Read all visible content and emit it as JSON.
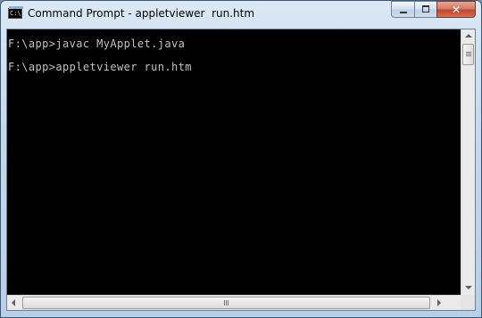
{
  "window": {
    "title": "Command Prompt - appletviewer  run.htm",
    "icon": "console-icon",
    "icon_text": "C:\\"
  },
  "caption_buttons": {
    "minimize": "minimize-icon",
    "maximize": "maximize-icon",
    "close_label": "✕"
  },
  "console": {
    "lines": [
      "F:\\app>javac MyApplet.java",
      "F:\\app>appletviewer run.htm"
    ],
    "background": "#000000",
    "foreground": "#c0c0c0"
  },
  "colors": {
    "titlebar": "#c6d9ec",
    "close_button": "#c0462b"
  }
}
